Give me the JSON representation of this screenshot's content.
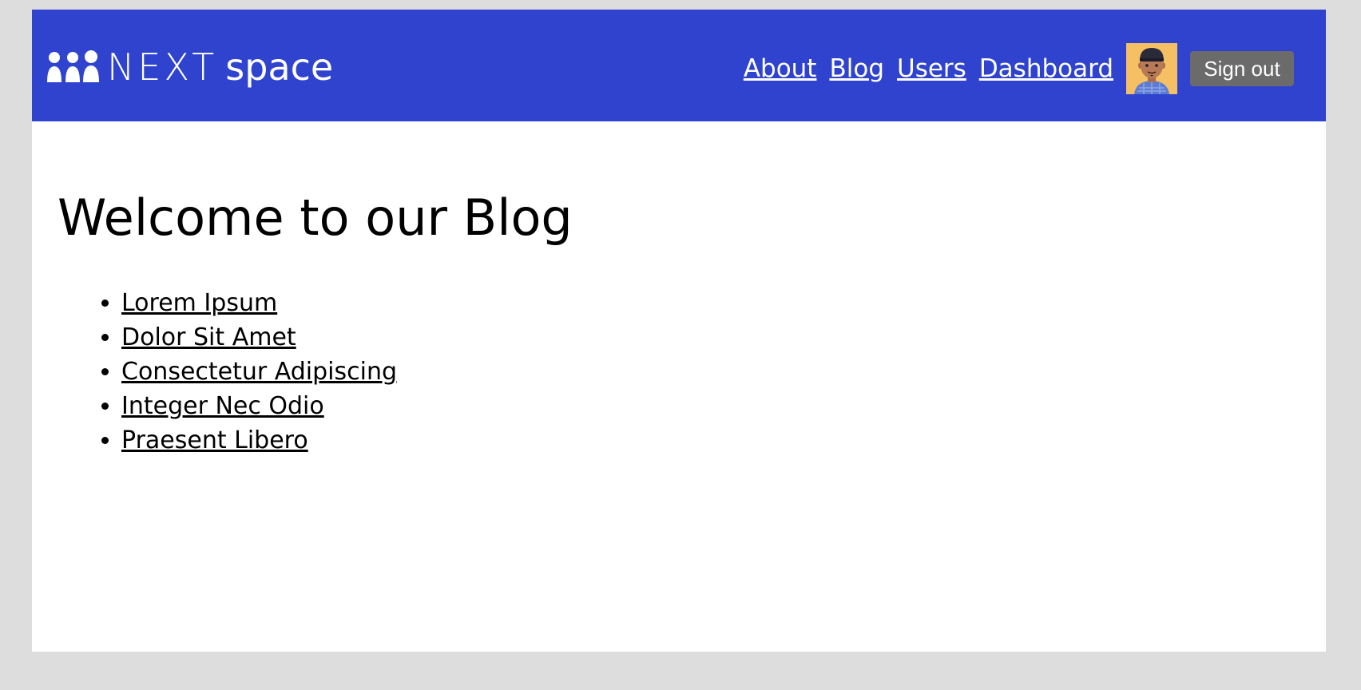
{
  "header": {
    "logo": {
      "next": "NEXT",
      "space": "space"
    },
    "nav": [
      {
        "label": "About"
      },
      {
        "label": "Blog"
      },
      {
        "label": "Users"
      },
      {
        "label": "Dashboard"
      }
    ],
    "signout_label": "Sign out"
  },
  "main": {
    "title": "Welcome to our Blog",
    "posts": [
      {
        "label": "Lorem Ipsum"
      },
      {
        "label": "Dolor Sit Amet"
      },
      {
        "label": "Consectetur Adipiscing"
      },
      {
        "label": "Integer Nec Odio"
      },
      {
        "label": "Praesent Libero"
      }
    ]
  },
  "colors": {
    "page_background": "#dddddd",
    "navbar": "#2f43cf",
    "signout_button": "#6b6b6b",
    "content_background": "#ffffff"
  },
  "icons": {
    "logo": "people-group-icon",
    "avatar": "user-avatar"
  }
}
